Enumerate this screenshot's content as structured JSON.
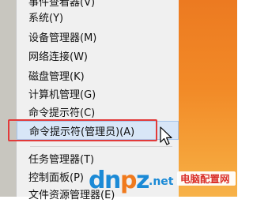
{
  "menu": {
    "items": [
      {
        "label": "事件查看器(V)"
      },
      {
        "label": "系统(Y)"
      },
      {
        "label": "设备管理器(M)"
      },
      {
        "label": "网络连接(W)"
      },
      {
        "label": "磁盘管理(K)"
      },
      {
        "label": "计算机管理(G)"
      },
      {
        "label": "命令提示符(C)"
      },
      {
        "label": "命令提示符(管理员)(A)"
      },
      {
        "label": "任务管理器(T)"
      },
      {
        "label": "控制面板(P)"
      },
      {
        "label": "文件资源管理器(E)"
      }
    ]
  },
  "watermark": {
    "logo_text": "dnpz.net",
    "badge_text": "电脑配置网",
    "colors": {
      "logo_blue": "#1b8ad6",
      "logo_orange": "#f07a1d",
      "badge_red": "#d9302a"
    }
  },
  "colors": {
    "highlight_border": "#e23a3a",
    "accent": "#ec7a21"
  }
}
